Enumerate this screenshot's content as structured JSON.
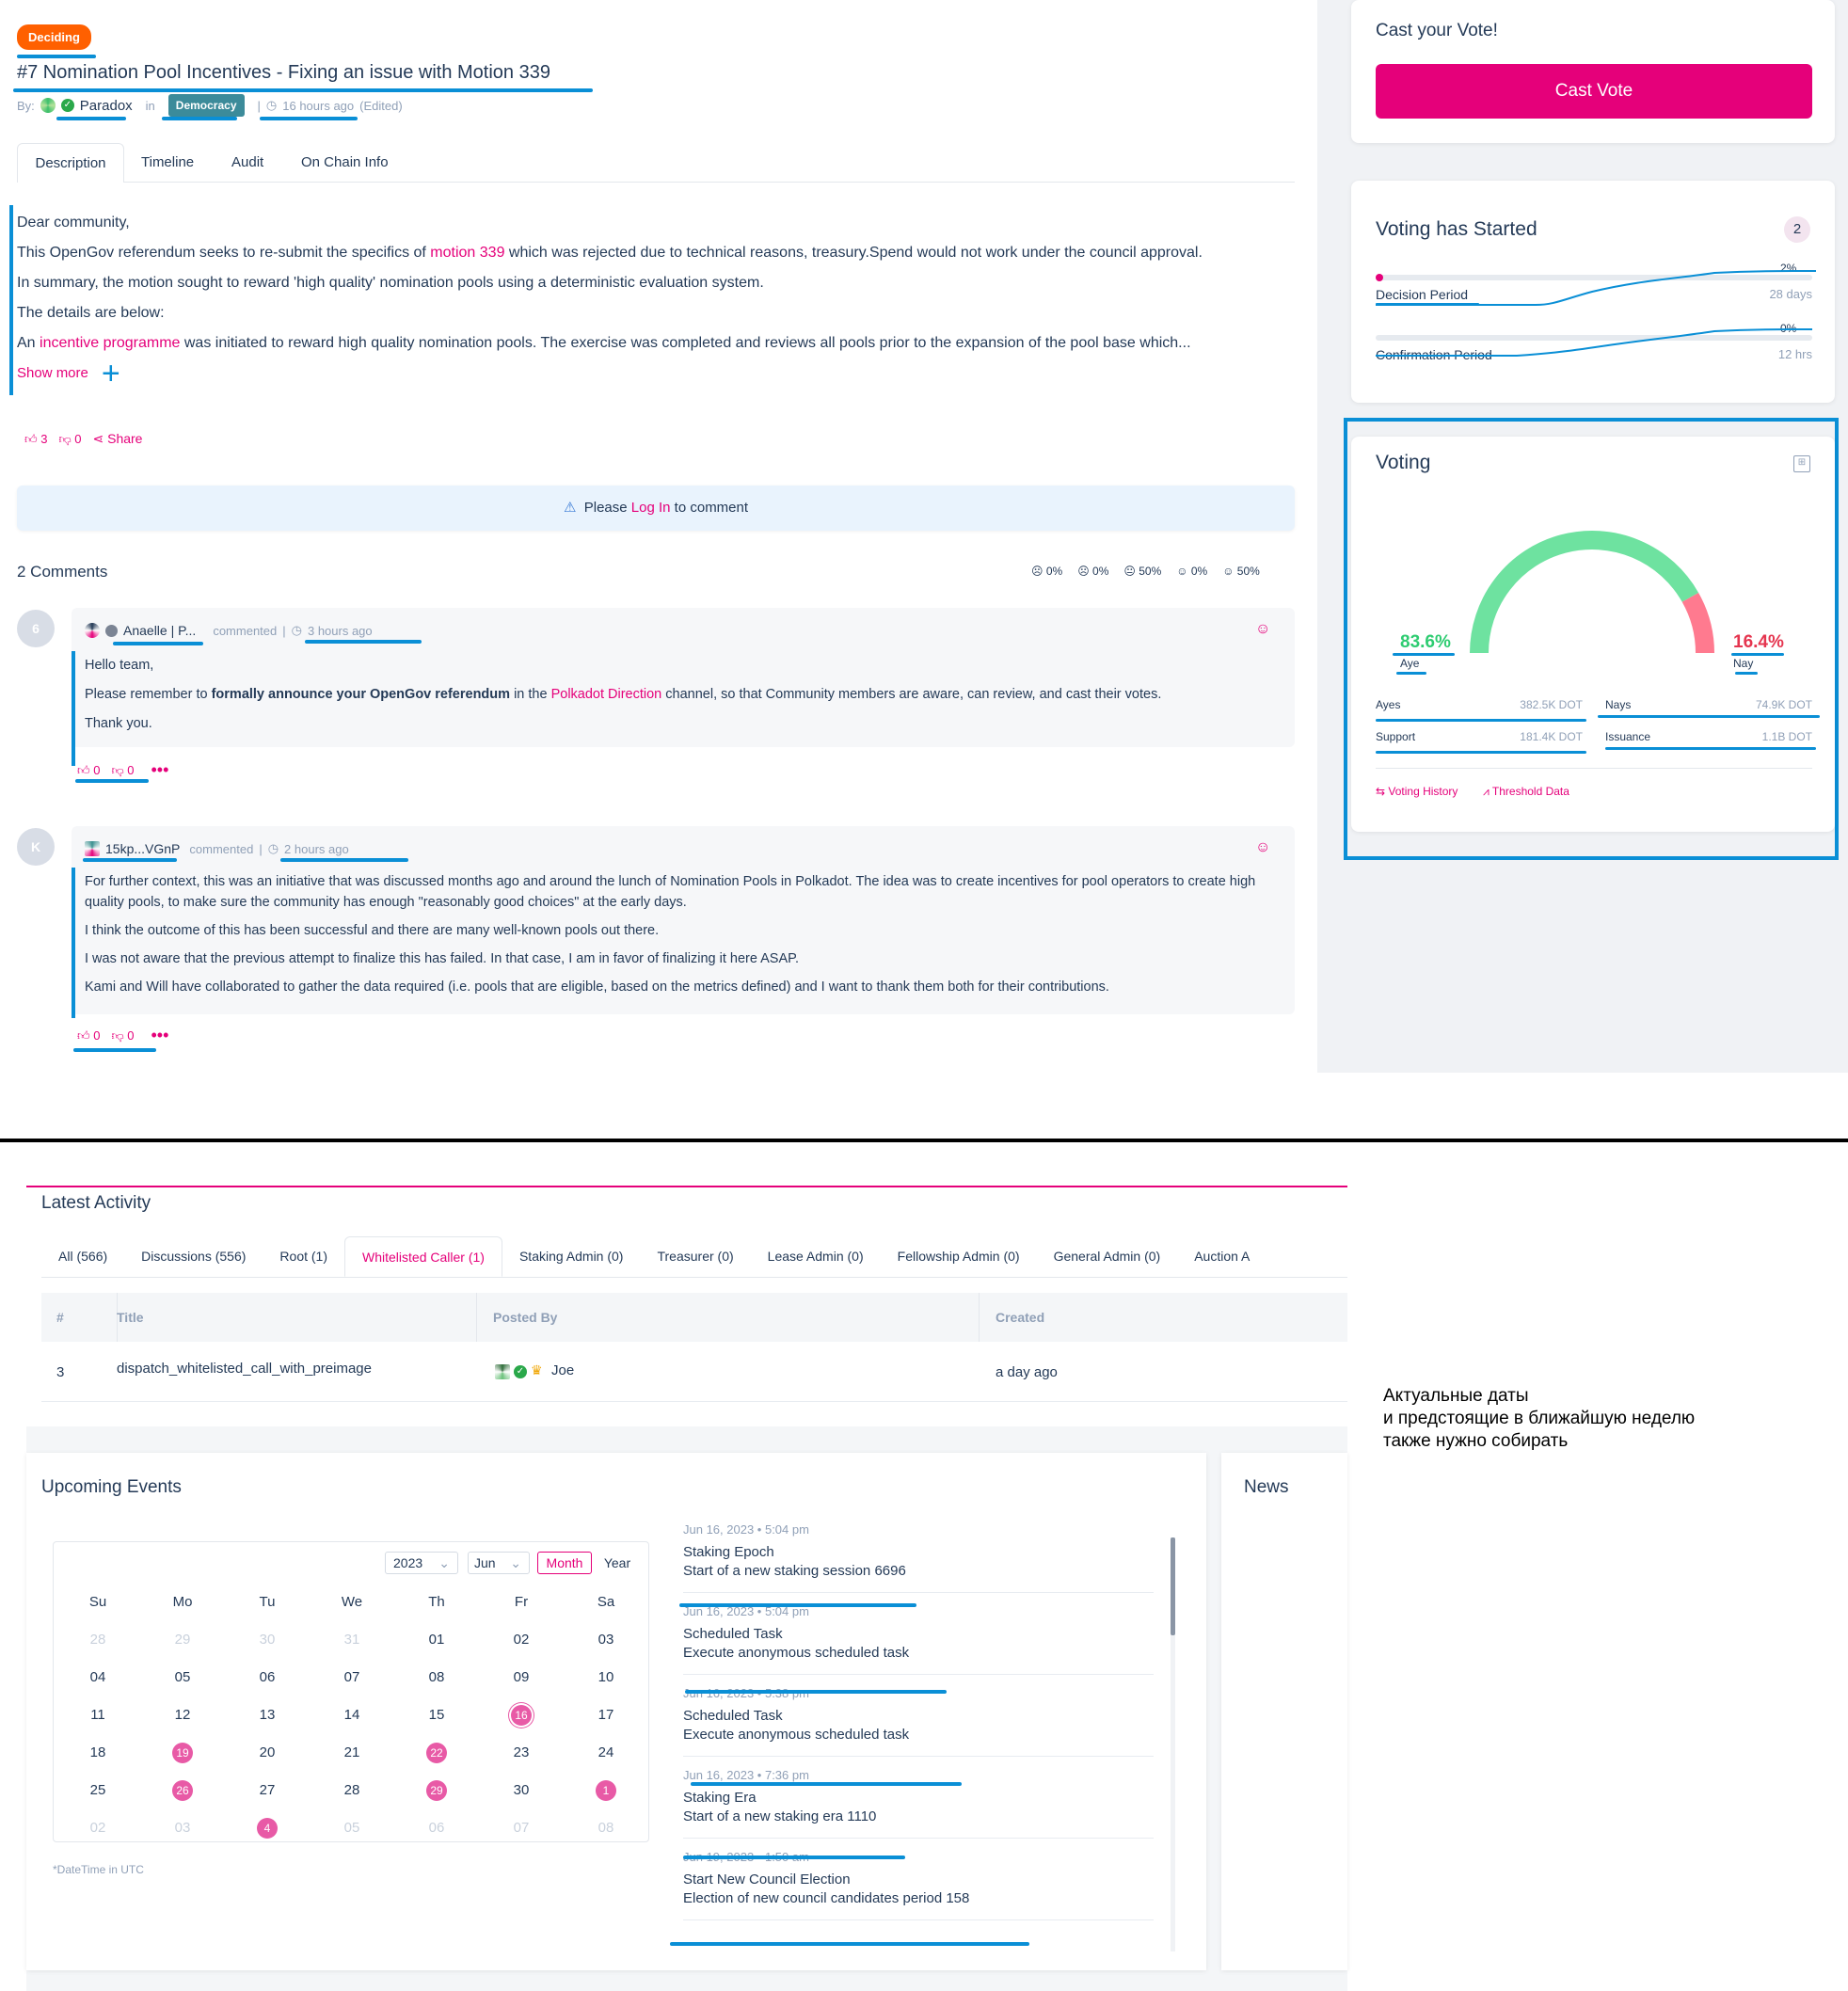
{
  "referendum": {
    "status": "Deciding",
    "title": "#7 Nomination Pool Incentives - Fixing an issue with Motion 339",
    "by_label": "By:",
    "author": "Paradox",
    "in_label": "in",
    "track": "Democracy",
    "time": "16 hours ago",
    "edited": "(Edited)",
    "tabs": [
      "Description",
      "Timeline",
      "Audit",
      "On Chain Info"
    ],
    "greeting": "Dear community,",
    "para1_a": "This OpenGov referendum seeks to re-submit the specifics of ",
    "para1_link": "motion 339",
    "para1_b": " which was rejected due to technical reasons, treasury.Spend would not work under the council approval.",
    "para2": "In summary, the motion sought to reward 'high quality' nomination pools using a deterministic evaluation system.",
    "para3": "The details are below:",
    "para4_a": "An ",
    "para4_link": "incentive programme",
    "para4_b": " was initiated to reward high quality nomination pools. The exercise was completed and reviews all pools prior to the expansion of the pool base which...",
    "show_more": "Show more",
    "likes": "3",
    "dislikes": "0",
    "share": "Share",
    "login_prefix": "Please",
    "login_link": "Log In",
    "login_suffix": "to comment"
  },
  "comments_header": {
    "count": "2 Comments",
    "sentiments": [
      "0%",
      "0%",
      "50%",
      "0%",
      "50%"
    ]
  },
  "comments": [
    {
      "avatar": "6",
      "author": "Anaelle | P...",
      "action": "commented",
      "time": "3 hours ago",
      "line1": "Hello team,",
      "line2_a": "Please remember to ",
      "line2_bold": "formally announce your OpenGov referendum",
      "line2_b": " in the ",
      "line2_link": "Polkadot Direction",
      "line2_c": " channel, so that Community members are aware, can review, and cast their votes.",
      "line3": "Thank you.",
      "likes": "0",
      "dislikes": "0"
    },
    {
      "avatar": "K",
      "author": "15kp...VGnP",
      "action": "commented",
      "time": "2 hours ago",
      "p1": "For further context, this was an initiative that was discussed months ago and around the lunch of Nomination Pools in Polkadot. The idea was to create incentives for pool operators to create high quality pools, to make sure the community has enough \"reasonably good choices\" at the early days.",
      "p2": "I think the outcome of this has been successful and there are many well-known pools out there.",
      "p3": "I was not aware that the previous attempt to finalize this has failed. In that case, I am in favor of finalizing it here ASAP.",
      "p4": "Kami and Will have collaborated to gather the data required (i.e. pools that are eligible, based on the metrics defined) and I want to thank them both for their contributions.",
      "likes": "0",
      "dislikes": "0"
    }
  ],
  "cast_vote": {
    "heading": "Cast your Vote!",
    "button": "Cast Vote",
    "color": "#e5007a"
  },
  "voting_started": {
    "heading": "Voting has Started",
    "badge": "2",
    "decision_label": "Decision Period",
    "decision_pct": "2%",
    "decision_value": "28 days",
    "confirmation_label": "Confirmation Period",
    "confirmation_pct": "0%",
    "confirmation_value": "12 hrs"
  },
  "voting": {
    "heading": "Voting",
    "aye_pct": "83.6%",
    "aye_label": "Aye",
    "nay_pct": "16.4%",
    "nay_label": "Nay",
    "aye_fraction": 0.836,
    "ayes_label": "Ayes",
    "ayes_value": "382.5K DOT",
    "nays_label": "Nays",
    "nays_value": "74.9K DOT",
    "support_label": "Support",
    "support_value": "181.4K DOT",
    "issuance_label": "Issuance",
    "issuance_value": "1.1B DOT",
    "history_link": "Voting History",
    "threshold_link": "Threshold Data",
    "aye_color": "#6ee2a0",
    "nay_color": "#ff7a8f"
  },
  "activity": {
    "heading": "Latest Activity",
    "tabs": [
      {
        "label": "All",
        "count": "(566)"
      },
      {
        "label": "Discussions",
        "count": "(556)"
      },
      {
        "label": "Root",
        "count": "(1)"
      },
      {
        "label": "Whitelisted Caller",
        "count": "(1)"
      },
      {
        "label": "Staking Admin",
        "count": "(0)"
      },
      {
        "label": "Treasurer",
        "count": "(0)"
      },
      {
        "label": "Lease Admin",
        "count": "(0)"
      },
      {
        "label": "Fellowship Admin",
        "count": "(0)"
      },
      {
        "label": "General Admin",
        "count": "(0)"
      },
      {
        "label": "Auction A",
        "count": ""
      }
    ],
    "columns": [
      "#",
      "Title",
      "Posted By",
      "Created"
    ],
    "rows": [
      {
        "num": "3",
        "title": "dispatch_whitelisted_call_with_preimage",
        "poster": "Joe",
        "created": "a day ago"
      }
    ]
  },
  "note": {
    "line1": "Актуальные даты",
    "line2": "и предстоящие в ближайшую неделю",
    "line3": "также нужно собирать"
  },
  "events": {
    "heading": "Upcoming Events",
    "year": "2023",
    "month": "Jun",
    "view_month": "Month",
    "view_year": "Year",
    "weekdays": [
      "Su",
      "Mo",
      "Tu",
      "We",
      "Th",
      "Fr",
      "Sa"
    ],
    "days": [
      {
        "d": "28",
        "off": true
      },
      {
        "d": "29",
        "off": true
      },
      {
        "d": "30",
        "off": true
      },
      {
        "d": "31",
        "off": true
      },
      {
        "d": "01"
      },
      {
        "d": "02"
      },
      {
        "d": "03"
      },
      {
        "d": "04"
      },
      {
        "d": "05"
      },
      {
        "d": "06"
      },
      {
        "d": "07"
      },
      {
        "d": "08"
      },
      {
        "d": "09"
      },
      {
        "d": "10"
      },
      {
        "d": "11"
      },
      {
        "d": "12"
      },
      {
        "d": "13"
      },
      {
        "d": "14"
      },
      {
        "d": "15"
      },
      {
        "d": "16",
        "today": true
      },
      {
        "d": "17"
      },
      {
        "d": "18"
      },
      {
        "d": "19",
        "event": true
      },
      {
        "d": "20"
      },
      {
        "d": "21"
      },
      {
        "d": "22",
        "event": true
      },
      {
        "d": "23"
      },
      {
        "d": "24"
      },
      {
        "d": "25"
      },
      {
        "d": "26",
        "event": true
      },
      {
        "d": "27"
      },
      {
        "d": "28"
      },
      {
        "d": "29",
        "event": true
      },
      {
        "d": "30"
      },
      {
        "d": "1",
        "event": true
      },
      {
        "d": "02",
        "off": true
      },
      {
        "d": "03",
        "off": true
      },
      {
        "d": "4",
        "event": true
      },
      {
        "d": "05",
        "off": true
      },
      {
        "d": "06",
        "off": true
      },
      {
        "d": "07",
        "off": true
      },
      {
        "d": "08",
        "off": true
      }
    ],
    "tz_note": "*DateTime in UTC",
    "list": [
      {
        "date": "Jun 16, 2023",
        "time": "5:04 pm",
        "title": "Staking Epoch",
        "desc": "Start of a new staking session 6696"
      },
      {
        "date": "Jun 16, 2023",
        "time": "5:04 pm",
        "title": "Scheduled Task",
        "desc": "Execute anonymous scheduled task"
      },
      {
        "date": "Jun 16, 2023",
        "time": "5:38 pm",
        "title": "Scheduled Task",
        "desc": "Execute anonymous scheduled task"
      },
      {
        "date": "Jun 16, 2023",
        "time": "7:36 pm",
        "title": "Staking Era",
        "desc": "Start of a new staking era 1110"
      },
      {
        "date": "Jun 19, 2023",
        "time": "1:50 am",
        "title": "Start New Council Election",
        "desc": "Election of new council candidates period 158"
      }
    ]
  },
  "news": {
    "heading": "News"
  }
}
